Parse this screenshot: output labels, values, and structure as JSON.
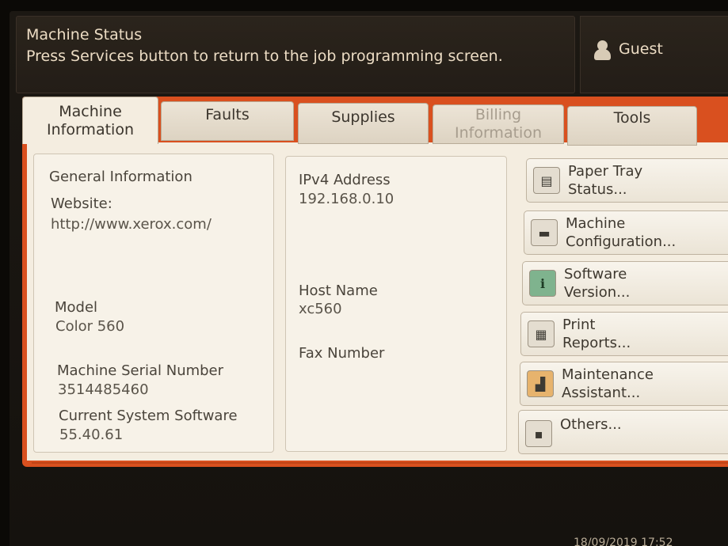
{
  "header": {
    "title": "Machine Status",
    "subtitle": "Press Services button to return to the job programming screen."
  },
  "user": {
    "label": "Guest",
    "icon": "user-icon"
  },
  "tabs": [
    {
      "label_line1": "Machine",
      "label_line2": "Information",
      "state": "active"
    },
    {
      "label_line1": "Faults",
      "label_line2": "",
      "state": "normal"
    },
    {
      "label_line1": "Supplies",
      "label_line2": "",
      "state": "normal"
    },
    {
      "label_line1": "Billing",
      "label_line2": "Information",
      "state": "disabled"
    },
    {
      "label_line1": "Tools",
      "label_line2": "",
      "state": "normal"
    }
  ],
  "general": {
    "heading": "General Information",
    "website_label": "Website:",
    "website_value": "http://www.xerox.com/",
    "model_label": "Model",
    "model_value": "Color 560",
    "serial_label": "Machine Serial Number",
    "serial_value": "3514485460",
    "software_label": "Current System Software",
    "software_value": "55.40.61"
  },
  "network": {
    "ipv4_label": "IPv4 Address",
    "ipv4_value": "192.168.0.10",
    "host_label": "Host Name",
    "host_value": "xc560",
    "fax_label": "Fax Number"
  },
  "side_buttons": [
    {
      "line1": "Paper Tray",
      "line2": "Status...",
      "icon": "paper-tray-icon"
    },
    {
      "line1": "Machine",
      "line2": "Configuration...",
      "icon": "printer-icon"
    },
    {
      "line1": "Software",
      "line2": "Version...",
      "icon": "info-icon"
    },
    {
      "line1": "Print",
      "line2": "Reports...",
      "icon": "report-icon"
    },
    {
      "line1": "Maintenance",
      "line2": "Assistant...",
      "icon": "maintenance-icon"
    },
    {
      "line1": "Others...",
      "line2": "",
      "icon": "others-icon"
    }
  ],
  "clock": "18/09/2019 17:52",
  "colors": {
    "accent": "#d9501f",
    "panel": "#f4ede0",
    "header": "#231d17"
  }
}
